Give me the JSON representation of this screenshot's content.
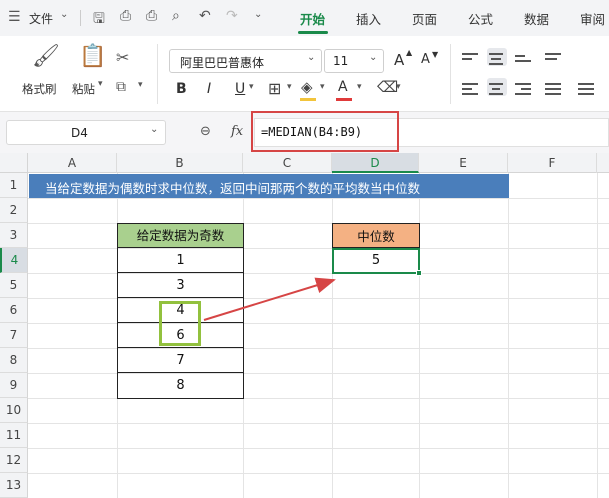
{
  "menubar": {
    "file_label": "文件",
    "tabs": [
      "开始",
      "插入",
      "页面",
      "公式",
      "数据",
      "审阅"
    ]
  },
  "ribbon": {
    "format_painter": "格式刷",
    "paste": "粘贴",
    "font_name": "阿里巴巴普惠体",
    "font_size": "11",
    "bold": "B",
    "italic": "I",
    "underline": "U",
    "grow_font": "A",
    "shrink_font": "A",
    "font_color": "A"
  },
  "formula_bar": {
    "name_box": "D4",
    "fx_label": "fx",
    "formula": "=MEDIAN(B4:B9)"
  },
  "sheet": {
    "columns": [
      "A",
      "B",
      "C",
      "D",
      "E",
      "F"
    ],
    "rows": [
      "1",
      "2",
      "3",
      "4",
      "5",
      "6",
      "7",
      "8",
      "9",
      "10",
      "11",
      "12",
      "13"
    ],
    "title_banner": "当给定数据为偶数时求中位数，返回中间那两个数的平均数当中位数",
    "data_header": "给定数据为奇数",
    "data_values": [
      "1",
      "3",
      "4",
      "6",
      "7",
      "8"
    ],
    "median_header": "中位数",
    "median_value": "5"
  },
  "colors": {
    "accent": "#1a8a4a",
    "banner_bg": "#4a7ebb",
    "data_header_bg": "#a9d08e",
    "median_header_bg": "#f4b183",
    "highlight_border": "#92c13e",
    "formula_box_border": "#d64545",
    "arrow": "#d64545"
  }
}
